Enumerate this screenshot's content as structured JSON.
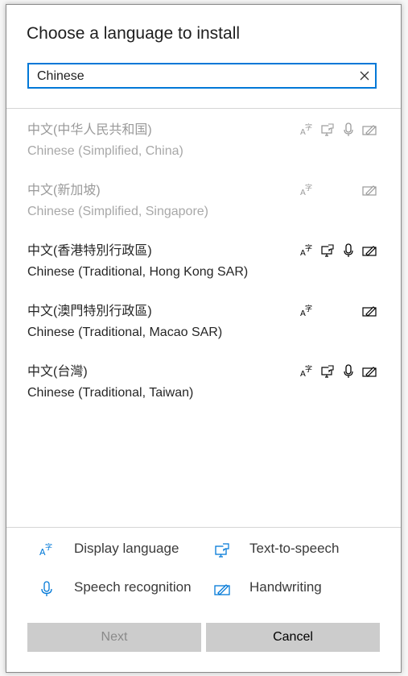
{
  "dialog": {
    "title": "Choose a language to install",
    "search": {
      "value": "Chinese",
      "placeholder": ""
    }
  },
  "languages": [
    {
      "native": "中文(中华人民共和国)",
      "english": "Chinese (Simplified, China)",
      "installed": true,
      "features": [
        "display-language",
        "text-to-speech",
        "speech-recognition",
        "handwriting"
      ]
    },
    {
      "native": "中文(新加坡)",
      "english": "Chinese (Simplified, Singapore)",
      "installed": true,
      "features": [
        "display-language",
        "handwriting"
      ]
    },
    {
      "native": "中文(香港特別行政區)",
      "english": "Chinese (Traditional, Hong Kong SAR)",
      "installed": false,
      "features": [
        "display-language",
        "text-to-speech",
        "speech-recognition",
        "handwriting"
      ]
    },
    {
      "native": "中文(澳門特別行政區)",
      "english": "Chinese (Traditional, Macao SAR)",
      "installed": false,
      "features": [
        "display-language",
        "handwriting"
      ]
    },
    {
      "native": "中文(台灣)",
      "english": "Chinese (Traditional, Taiwan)",
      "installed": false,
      "features": [
        "display-language",
        "text-to-speech",
        "speech-recognition",
        "handwriting"
      ]
    }
  ],
  "legend": {
    "display_language": "Display language",
    "text_to_speech": "Text-to-speech",
    "speech_recognition": "Speech recognition",
    "handwriting": "Handwriting"
  },
  "buttons": {
    "next": "Next",
    "cancel": "Cancel"
  },
  "colors": {
    "accent": "#0078d7",
    "button_bg": "#cccccc"
  }
}
